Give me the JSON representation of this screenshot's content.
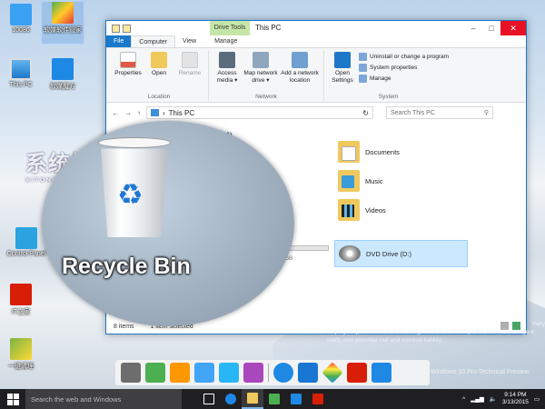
{
  "desktop": {
    "icons": [
      {
        "label": "10086",
        "icon": "user-icon"
      },
      {
        "label": "软媒软件管家",
        "icon": "app-manager-icon"
      },
      {
        "label": "This PC",
        "icon": "computer-icon"
      },
      {
        "label": "软媒魔方",
        "icon": "cube-icon"
      },
      {
        "label": "Control Panel",
        "icon": "control-panel-icon"
      },
      {
        "label": "IT之家",
        "icon": "ithome-icon"
      },
      {
        "label": "一键清理",
        "icon": "cleaner-icon"
      }
    ],
    "watermark": {
      "main": "系统城",
      "sub": "XITONGCHENG.COM"
    },
    "magnifier_label": "Recycle Bin",
    "magnifier_icon": "recycle-bin-icon",
    "faded_text": "employees), termination of an assignment or contract (in the case of contingent staff), and potential civil and criminal liability.",
    "faded_text_prefix": "mary",
    "windows_version": "Windows 10 Pro Technical Preview"
  },
  "explorer": {
    "title": "This PC",
    "context_tab": "Drive Tools",
    "tabs": [
      "File",
      "Computer",
      "View",
      "Manage"
    ],
    "ribbon": {
      "location": {
        "caption": "Location",
        "buttons": [
          "Properties",
          "Open",
          "Rename"
        ]
      },
      "network": {
        "caption": "Network",
        "buttons": [
          "Access media ▾",
          "Map network drive ▾",
          "Add a network location"
        ]
      },
      "system": {
        "caption": "System",
        "open_settings": "Open Settings",
        "items": [
          "Uninstall or change a program",
          "System properties",
          "Manage"
        ]
      }
    },
    "address": {
      "path": "This PC",
      "search_placeholder": "Search This PC"
    },
    "section_title": "ders (6)",
    "folders": [
      "Documents",
      "Music",
      "Videos"
    ],
    "drive": {
      "label": "DVD Drive (D:)",
      "disk_text": "GB",
      "usage_fraction": 0.15
    },
    "status": {
      "items": "8 items",
      "selected": "1 item selected"
    }
  },
  "dock": {
    "icons": [
      "folder-gray-icon",
      "games-icon",
      "store-bag-icon",
      "folder-blue-icon",
      "lock-folder-icon",
      "tools-icon",
      "ie-icon",
      "explorer-tiles-icon",
      "colorful-diamond-icon",
      "ithome-icon",
      "search-icon"
    ]
  },
  "taskbar": {
    "search_placeholder": "Search the web and Windows",
    "apps": [
      "task-view-icon",
      "ie-icon",
      "file-explorer-icon",
      "store-icon",
      "tiles-icon",
      "ithome-icon"
    ],
    "time": "9:14 PM",
    "date": "3/13/2015",
    "colors": {
      "accent": "#1979ca",
      "taskbar": "#1f1f21"
    }
  }
}
